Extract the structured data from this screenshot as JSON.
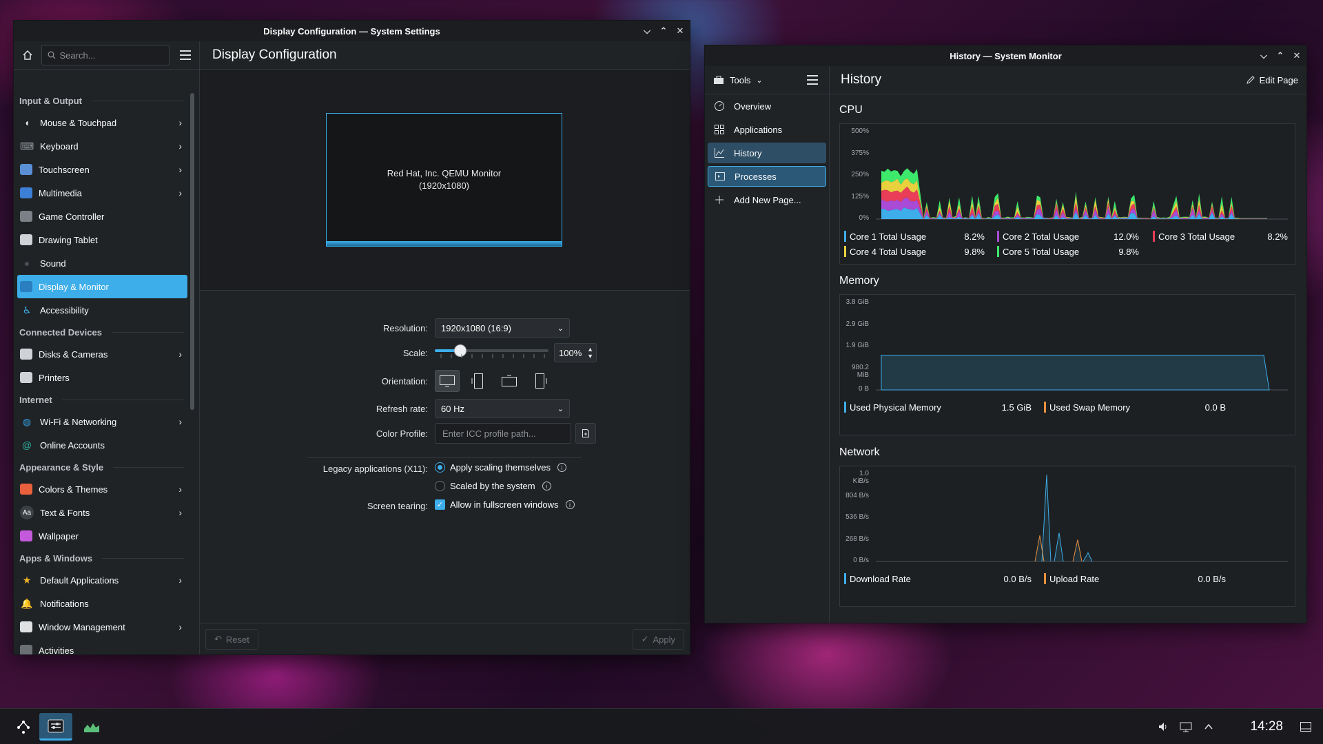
{
  "settings_window": {
    "title": "Display Configuration — System Settings",
    "search_placeholder": "Search...",
    "page_title": "Display Configuration",
    "sidebar": [
      {
        "category": "Input & Output",
        "items": [
          {
            "label": "Mouse & Touchpad",
            "icon": "mouse-icon",
            "chevron": true
          },
          {
            "label": "Keyboard",
            "icon": "keyboard-icon",
            "chevron": true
          },
          {
            "label": "Touchscreen",
            "icon": "touchscreen-icon",
            "chevron": true
          },
          {
            "label": "Multimedia",
            "icon": "multimedia-icon",
            "chevron": true
          },
          {
            "label": "Game Controller",
            "icon": "gamepad-icon",
            "chevron": false
          },
          {
            "label": "Drawing Tablet",
            "icon": "tablet-icon",
            "chevron": false
          },
          {
            "label": "Sound",
            "icon": "sound-icon",
            "chevron": false
          },
          {
            "label": "Display & Monitor",
            "icon": "display-icon",
            "chevron": false,
            "active": true
          },
          {
            "label": "Accessibility",
            "icon": "accessibility-icon",
            "chevron": false
          }
        ]
      },
      {
        "category": "Connected Devices",
        "items": [
          {
            "label": "Disks & Cameras",
            "icon": "disk-icon",
            "chevron": true
          },
          {
            "label": "Printers",
            "icon": "printer-icon",
            "chevron": false
          }
        ]
      },
      {
        "category": "Internet",
        "items": [
          {
            "label": "Wi-Fi & Networking",
            "icon": "globe-icon",
            "chevron": true
          },
          {
            "label": "Online Accounts",
            "icon": "accounts-icon",
            "chevron": false
          }
        ]
      },
      {
        "category": "Appearance & Style",
        "items": [
          {
            "label": "Colors & Themes",
            "icon": "palette-icon",
            "chevron": true
          },
          {
            "label": "Text & Fonts",
            "icon": "fonts-icon",
            "chevron": true
          },
          {
            "label": "Wallpaper",
            "icon": "wallpaper-icon",
            "chevron": false
          }
        ]
      },
      {
        "category": "Apps & Windows",
        "items": [
          {
            "label": "Default Applications",
            "icon": "star-icon",
            "chevron": true
          },
          {
            "label": "Notifications",
            "icon": "bell-icon",
            "chevron": false
          },
          {
            "label": "Window Management",
            "icon": "window-icon",
            "chevron": true
          },
          {
            "label": "Activities",
            "icon": "activities-icon",
            "chevron": false
          }
        ]
      }
    ],
    "monitor_name": "Red Hat, Inc. QEMU Monitor",
    "monitor_res": "(1920x1080)",
    "form": {
      "resolution_label": "Resolution:",
      "resolution_value": "1920x1080 (16:9)",
      "scale_label": "Scale:",
      "scale_value": "100%",
      "scale_level_percent": 25,
      "orientation_label": "Orientation:",
      "refresh_label": "Refresh rate:",
      "refresh_value": "60 Hz",
      "color_profile_label": "Color Profile:",
      "color_profile_placeholder": "Enter ICC profile path...",
      "legacy_label": "Legacy applications (X11):",
      "legacy_option1": "Apply scaling themselves",
      "legacy_option2": "Scaled by the system",
      "tearing_label": "Screen tearing:",
      "tearing_option": "Allow in fullscreen windows"
    },
    "footer": {
      "reset": "Reset",
      "apply": "Apply"
    }
  },
  "monitor_window": {
    "title": "History — System Monitor",
    "tools_label": "Tools",
    "page_title": "History",
    "edit_page": "Edit Page",
    "nav": [
      {
        "label": "Overview",
        "icon": "overview-icon"
      },
      {
        "label": "Applications",
        "icon": "applications-icon"
      },
      {
        "label": "History",
        "icon": "history-icon"
      },
      {
        "label": "Processes",
        "icon": "processes-icon"
      },
      {
        "label": "Add New Page...",
        "icon": "plus-icon"
      }
    ],
    "cpu": {
      "title": "CPU",
      "ylabels": [
        "500%",
        "375%",
        "250%",
        "125%",
        "0%"
      ],
      "legend": [
        {
          "name": "Core 1 Total Usage",
          "value": "8.2%",
          "color": "#3daee9"
        },
        {
          "name": "Core 2 Total Usage",
          "value": "12.0%",
          "color": "#a94bd6"
        },
        {
          "name": "Core 3 Total Usage",
          "value": "8.2%",
          "color": "#e93d58"
        },
        {
          "name": "Core 4 Total Usage",
          "value": "9.8%",
          "color": "#e9d03d"
        },
        {
          "name": "Core 5 Total Usage",
          "value": "9.8%",
          "color": "#3de96b"
        }
      ]
    },
    "memory": {
      "title": "Memory",
      "ylabels": [
        "3.8 GiB",
        "2.9 GiB",
        "1.9 GiB",
        "980.2 MiB",
        "0 B"
      ],
      "legend": [
        {
          "name": "Used Physical Memory",
          "value": "1.5 GiB",
          "color": "#3daee9"
        },
        {
          "name": "Used Swap Memory",
          "value": "0.0 B",
          "color": "#e9913d"
        }
      ]
    },
    "network": {
      "title": "Network",
      "ylabels": [
        "1.0 KiB/s",
        "804 B/s",
        "536 B/s",
        "268 B/s",
        "0 B/s"
      ],
      "legend": [
        {
          "name": "Download Rate",
          "value": "0.0 B/s",
          "color": "#3daee9"
        },
        {
          "name": "Upload Rate",
          "value": "0.0 B/s",
          "color": "#e9913d"
        }
      ]
    }
  },
  "taskbar": {
    "clock": "14:28"
  },
  "colors": {
    "accent": "#3daee9",
    "window_bg": "#202326",
    "titlebar_bg": "#1b1d20"
  }
}
